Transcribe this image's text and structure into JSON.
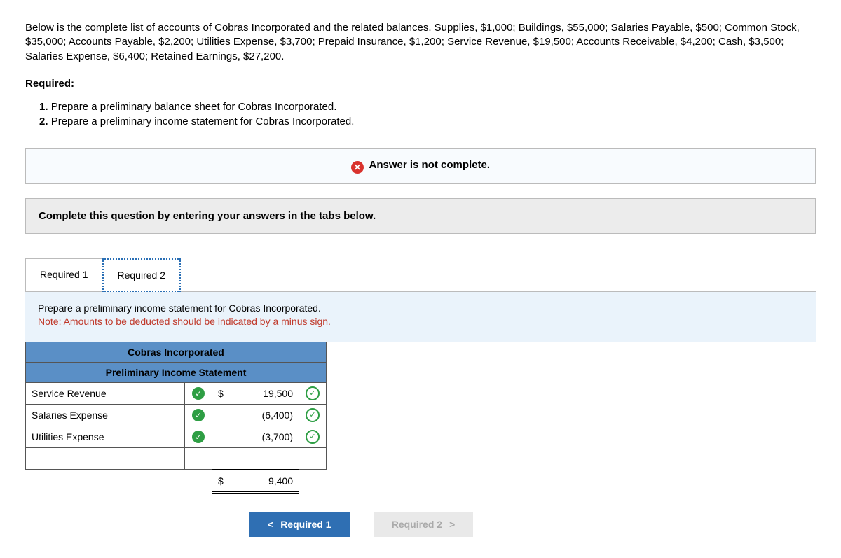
{
  "problem_text": "Below is the complete list of accounts of Cobras Incorporated and the related balances. Supplies, $1,000; Buildings, $55,000; Salaries Payable, $500; Common Stock, $35,000; Accounts Payable, $2,200; Utilities Expense, $3,700; Prepaid Insurance, $1,200; Service Revenue, $19,500; Accounts Receivable, $4,200; Cash, $3,500; Salaries Expense, $6,400; Retained Earnings, $27,200.",
  "required_heading": "Required:",
  "required_items": {
    "r1": "Prepare a preliminary balance sheet for Cobras Incorporated.",
    "r2": "Prepare a preliminary income statement for Cobras Incorporated."
  },
  "alert_text": "Answer is not complete.",
  "instruction_text": "Complete this question by entering your answers in the tabs below.",
  "tabs": {
    "t1": "Required 1",
    "t2": "Required 2"
  },
  "tab_body": {
    "line1": "Prepare a preliminary income statement for Cobras Incorporated.",
    "line2": "Note: Amounts to be deducted should be indicated by a minus sign."
  },
  "statement": {
    "company": "Cobras Incorporated",
    "title": "Preliminary Income Statement",
    "rows": {
      "r0": {
        "account": "Service Revenue",
        "currency": "$",
        "amount": "19,500"
      },
      "r1": {
        "account": "Salaries Expense",
        "currency": "",
        "amount": "(6,400)"
      },
      "r2": {
        "account": "Utilities Expense",
        "currency": "",
        "amount": "(3,700)"
      }
    },
    "total": {
      "currency": "$",
      "amount": "9,400"
    }
  },
  "nav": {
    "prev": "Required 1",
    "next": "Required 2"
  }
}
